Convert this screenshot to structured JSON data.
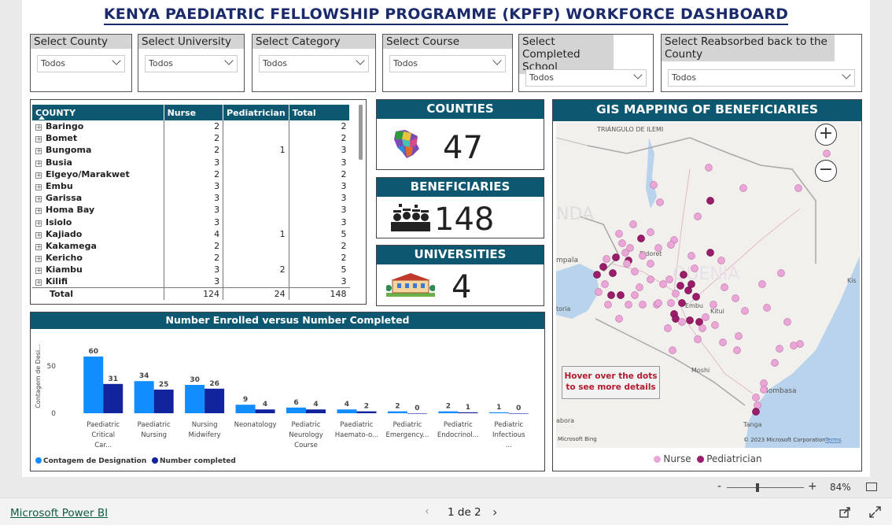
{
  "title": "KENYA PAEDIATRIC FELLOWSHIP PROGRAMME (KPFP) WORKFORCE DASHBOARD",
  "slicers": [
    {
      "label": "Select County",
      "value": "Todos"
    },
    {
      "label": "Select University",
      "value": "Todos"
    },
    {
      "label": "Select Category",
      "value": "Todos"
    },
    {
      "label": "Select Course",
      "value": "Todos"
    },
    {
      "label": "Select Completed School",
      "value": "Todos"
    },
    {
      "label": "Select Reabsorbed back to the County",
      "value": "Todos"
    }
  ],
  "table": {
    "headers": [
      "COUNTY",
      "Nurse",
      "Pediatrician",
      "Total"
    ],
    "rows": [
      {
        "county": "Baringo",
        "nurse": "2",
        "ped": "",
        "total": "2"
      },
      {
        "county": "Bomet",
        "nurse": "2",
        "ped": "",
        "total": "2"
      },
      {
        "county": "Bungoma",
        "nurse": "2",
        "ped": "1",
        "total": "3"
      },
      {
        "county": "Busia",
        "nurse": "3",
        "ped": "",
        "total": "3"
      },
      {
        "county": "Elgeyo/Marakwet",
        "nurse": "2",
        "ped": "",
        "total": "2"
      },
      {
        "county": "Embu",
        "nurse": "3",
        "ped": "",
        "total": "3"
      },
      {
        "county": "Garissa",
        "nurse": "3",
        "ped": "",
        "total": "3"
      },
      {
        "county": "Homa Bay",
        "nurse": "3",
        "ped": "",
        "total": "3"
      },
      {
        "county": "Isiolo",
        "nurse": "3",
        "ped": "",
        "total": "3"
      },
      {
        "county": "Kajiado",
        "nurse": "4",
        "ped": "1",
        "total": "5"
      },
      {
        "county": "Kakamega",
        "nurse": "2",
        "ped": "",
        "total": "2"
      },
      {
        "county": "Kericho",
        "nurse": "2",
        "ped": "",
        "total": "2"
      },
      {
        "county": "Kiambu",
        "nurse": "3",
        "ped": "2",
        "total": "5"
      },
      {
        "county": "Kilifi",
        "nurse": "3",
        "ped": "",
        "total": "3"
      }
    ],
    "total": {
      "label": "Total",
      "nurse": "124",
      "ped": "24",
      "total": "148"
    }
  },
  "kpis": {
    "counties": {
      "label": "COUNTIES",
      "value": "47"
    },
    "beneficiaries": {
      "label": "BENEFICIARIES",
      "value": "148"
    },
    "universities": {
      "label": "UNIVERSITIES",
      "value": "4"
    }
  },
  "map": {
    "title": "GIS MAPPING OF BENEFICIARIES",
    "hover_note": "Hover over the dots to see more details",
    "legend": {
      "nurse": "Nurse",
      "ped": "Pediatrician"
    },
    "colors": {
      "nurse": "#e9a6d6",
      "ped": "#9b1c6a",
      "water": "#b9d3ec",
      "land": "#f2f0ec"
    },
    "place_labels": [
      "TRIÁNGULO DE ILEMI",
      "NDA",
      "mpala",
      "Eldoret",
      "QUENIA",
      "Embu",
      "Kitui",
      "toria",
      "Moshi",
      "Mombasa",
      "Tanga",
      "abora",
      "Kis"
    ],
    "copyright": "© 2023 Microsoft Corporation",
    "terms": "Terms",
    "bing": "Microsoft Bing"
  },
  "chart_data": {
    "type": "bar",
    "title": "Number Enrolled versus Number Completed",
    "ylabel": "Contagem de Desi...",
    "yticks": [
      0,
      50
    ],
    "ylim": [
      0,
      65
    ],
    "categories": [
      "Paediatric Critical Car...",
      "Paediatric Nursing",
      "Nursing Midwifery",
      "Neonatology",
      "Pediatric Neurology Course",
      "Paediatric Haemato-o...",
      "Pediatric Emergency...",
      "Pediatric Endocrinol...",
      "Pediatric Infectious ..."
    ],
    "series": [
      {
        "name": "Contagem de Designation",
        "color": "#118dff",
        "values": [
          60,
          34,
          30,
          9,
          6,
          4,
          2,
          2,
          1
        ]
      },
      {
        "name": "Number completed",
        "color": "#12239e",
        "values": [
          31,
          25,
          26,
          4,
          4,
          2,
          0,
          1,
          0
        ]
      }
    ],
    "legend_position": "bottom-left"
  },
  "zoom": {
    "minus": "-",
    "plus": "+",
    "level": "84%"
  },
  "footer": {
    "brand": "Microsoft Power BI",
    "page": "1 de 2"
  }
}
